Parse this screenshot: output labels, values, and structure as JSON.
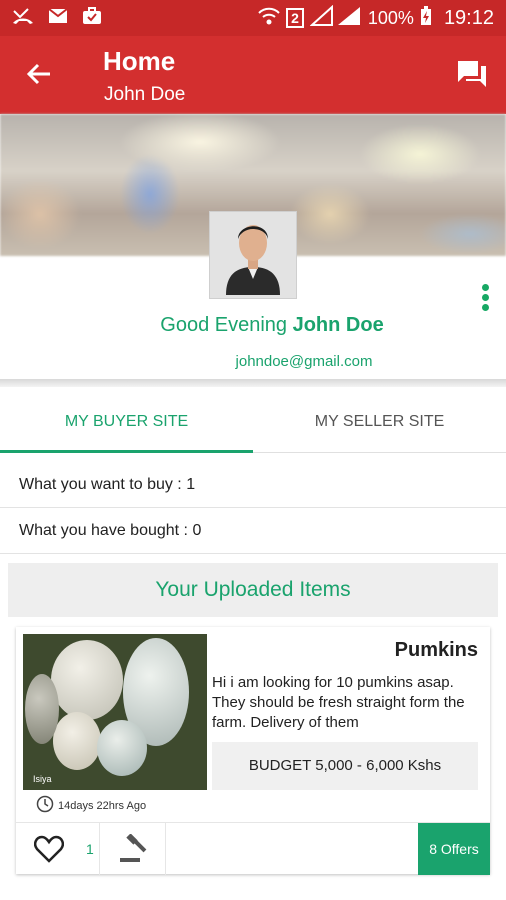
{
  "status_bar": {
    "battery": "100%",
    "time": "19:12",
    "sim_badge": "2",
    "icons": [
      "missed-call-icon",
      "mail-icon",
      "briefcase-icon",
      "wifi-icon",
      "signal-icon",
      "battery-charging-icon"
    ]
  },
  "app_bar": {
    "title": "Home",
    "subtitle": "John Doe",
    "back_icon": "arrow-back-icon",
    "chat_icon": "chat-icon"
  },
  "profile": {
    "greeting_prefix": "Good Evening",
    "name": "John Doe",
    "email": "johndoe@gmail.com"
  },
  "tabs": [
    {
      "label": "MY BUYER SITE",
      "active": true
    },
    {
      "label": "MY SELLER SITE",
      "active": false
    }
  ],
  "stats": {
    "want_to_buy": "What you want to buy : 1",
    "bought": "What you have bought : 0"
  },
  "section_title": "Your Uploaded Items",
  "item": {
    "image_caption": "Isiya",
    "title": "Pumkins",
    "description": "Hi i am looking for 10 pumkins asap. They should be fresh straight form the farm. Delivery of them",
    "budget": "BUDGET 5,000 - 6,000 Kshs",
    "posted": "14days 22hrs  Ago",
    "likes": "1",
    "offers": "8 Offers"
  },
  "colors": {
    "status_bar": "#c62828",
    "app_bar": "#d32f2f",
    "accent": "#1aa36d"
  }
}
